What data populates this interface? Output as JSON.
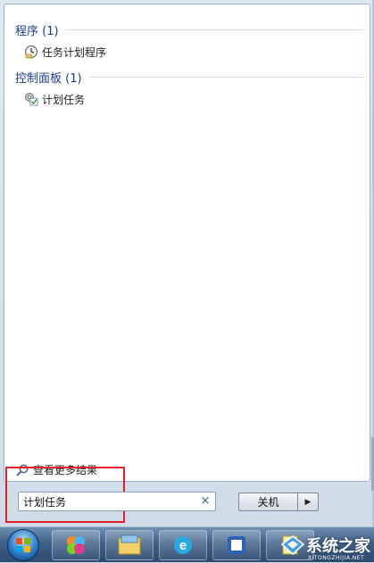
{
  "results": {
    "groups": [
      {
        "header": "程序 (1)",
        "items": [
          {
            "label": "任务计划程序",
            "icon": "task-scheduler-icon"
          }
        ]
      },
      {
        "header": "控制面板 (1)",
        "items": [
          {
            "label": "计划任务",
            "icon": "scheduled-tasks-icon"
          }
        ]
      }
    ],
    "more_results": "查看更多结果"
  },
  "search": {
    "value": "计划任务",
    "clear_symbol": "×"
  },
  "shutdown": {
    "label": "关机",
    "arrow": "▶"
  },
  "taskbar": {
    "items": [
      "windows-start-icon",
      "color-circles-app-icon",
      "file-explorer-icon",
      "ie-browser-icon",
      "media-app-icon",
      "document-app-icon"
    ]
  },
  "watermark": {
    "text": "系统之家",
    "sub": "XITONGZHIJIA.NET"
  },
  "colors": {
    "header_blue": "#1e3c8c",
    "highlight_red": "#e0202a",
    "clear_blue": "#2e5c9a"
  }
}
